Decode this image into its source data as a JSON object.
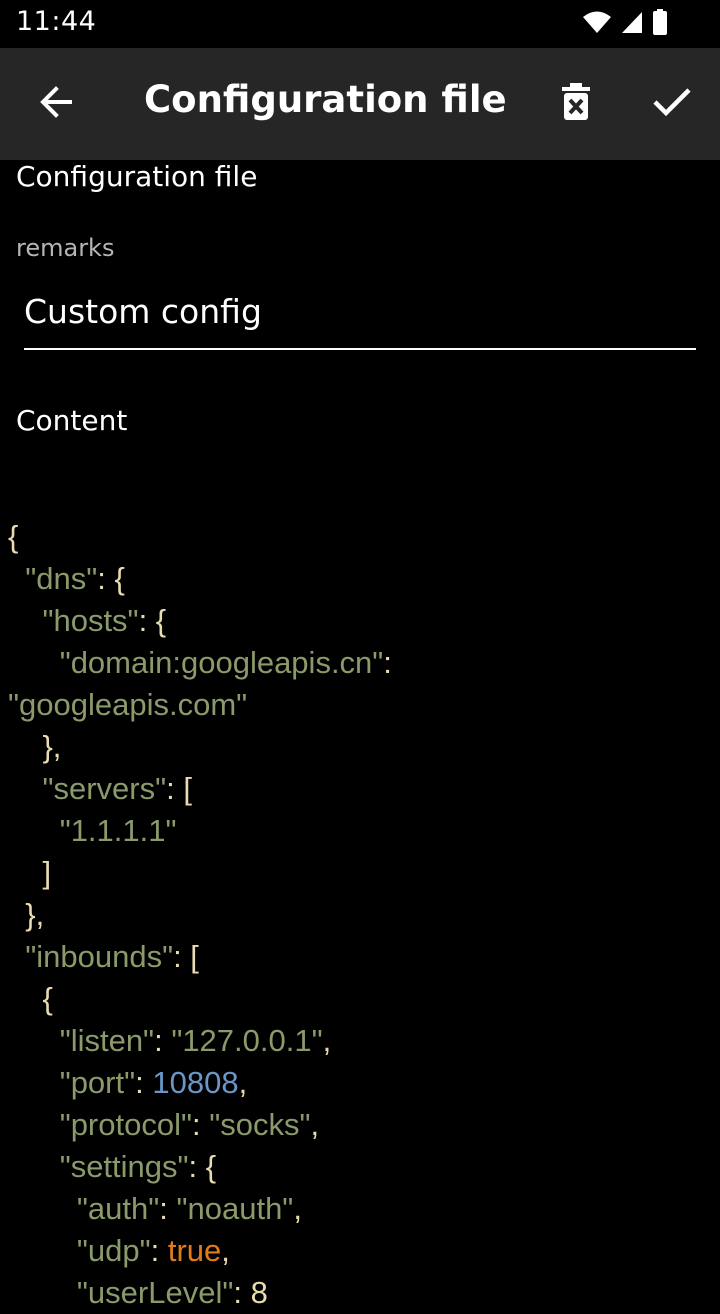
{
  "status_bar": {
    "time": "11:44",
    "icons": [
      "wifi-icon",
      "signal-icon",
      "battery-icon"
    ]
  },
  "app_bar": {
    "title": "Configuration file",
    "back_icon": "arrow-left-icon",
    "delete_icon": "delete-icon",
    "confirm_icon": "check-icon"
  },
  "form": {
    "section_title": "Configuration file",
    "remarks_label": "remarks",
    "remarks_value": "Custom config",
    "content_label": "Content"
  },
  "code_lines": [
    [
      {
        "t": "{",
        "c": "p"
      }
    ],
    [
      {
        "t": "  ",
        "c": "p"
      },
      {
        "t": "\"dns\"",
        "c": "k"
      },
      {
        "t": ": {",
        "c": "p"
      }
    ],
    [
      {
        "t": "    ",
        "c": "p"
      },
      {
        "t": "\"hosts\"",
        "c": "k"
      },
      {
        "t": ": {",
        "c": "p"
      }
    ],
    [
      {
        "t": "      ",
        "c": "p"
      },
      {
        "t": "\"domain:googleapis.cn\"",
        "c": "k"
      },
      {
        "t": ":",
        "c": "p"
      }
    ],
    [
      {
        "t": "\"googleapis.com\"",
        "c": "s"
      }
    ],
    [
      {
        "t": "    },",
        "c": "p"
      }
    ],
    [
      {
        "t": "    ",
        "c": "p"
      },
      {
        "t": "\"servers\"",
        "c": "k"
      },
      {
        "t": ": [",
        "c": "p"
      }
    ],
    [
      {
        "t": "      ",
        "c": "p"
      },
      {
        "t": "\"1.1.1.1\"",
        "c": "s"
      }
    ],
    [
      {
        "t": "    ]",
        "c": "p"
      }
    ],
    [
      {
        "t": "  },",
        "c": "p"
      }
    ],
    [
      {
        "t": "  ",
        "c": "p"
      },
      {
        "t": "\"inbounds\"",
        "c": "k"
      },
      {
        "t": ": [",
        "c": "p"
      }
    ],
    [
      {
        "t": "    {",
        "c": "p"
      }
    ],
    [
      {
        "t": "      ",
        "c": "p"
      },
      {
        "t": "\"listen\"",
        "c": "k"
      },
      {
        "t": ": ",
        "c": "p"
      },
      {
        "t": "\"127.0.0.1\"",
        "c": "s"
      },
      {
        "t": ",",
        "c": "p"
      }
    ],
    [
      {
        "t": "      ",
        "c": "p"
      },
      {
        "t": "\"port\"",
        "c": "k"
      },
      {
        "t": ": ",
        "c": "p"
      },
      {
        "t": "10808",
        "c": "n"
      },
      {
        "t": ",",
        "c": "p"
      }
    ],
    [
      {
        "t": "      ",
        "c": "p"
      },
      {
        "t": "\"protocol\"",
        "c": "k"
      },
      {
        "t": ": ",
        "c": "p"
      },
      {
        "t": "\"socks\"",
        "c": "s"
      },
      {
        "t": ",",
        "c": "p"
      }
    ],
    [
      {
        "t": "      ",
        "c": "p"
      },
      {
        "t": "\"settings\"",
        "c": "k"
      },
      {
        "t": ": {",
        "c": "p"
      }
    ],
    [
      {
        "t": "        ",
        "c": "p"
      },
      {
        "t": "\"auth\"",
        "c": "k"
      },
      {
        "t": ": ",
        "c": "p"
      },
      {
        "t": "\"noauth\"",
        "c": "s"
      },
      {
        "t": ",",
        "c": "p"
      }
    ],
    [
      {
        "t": "        ",
        "c": "p"
      },
      {
        "t": "\"udp\"",
        "c": "k"
      },
      {
        "t": ": ",
        "c": "p"
      },
      {
        "t": "true",
        "c": "b"
      },
      {
        "t": ",",
        "c": "p"
      }
    ],
    [
      {
        "t": "        ",
        "c": "p"
      },
      {
        "t": "\"userLevel\"",
        "c": "k"
      },
      {
        "t": ": 8",
        "c": "p"
      }
    ]
  ],
  "colors": {
    "background": "#000000",
    "app_bar": "#262626",
    "key": "#8a9a6a",
    "punctuation": "#e8dcb0",
    "number": "#6a97c7",
    "boolean": "#e07b1e"
  }
}
